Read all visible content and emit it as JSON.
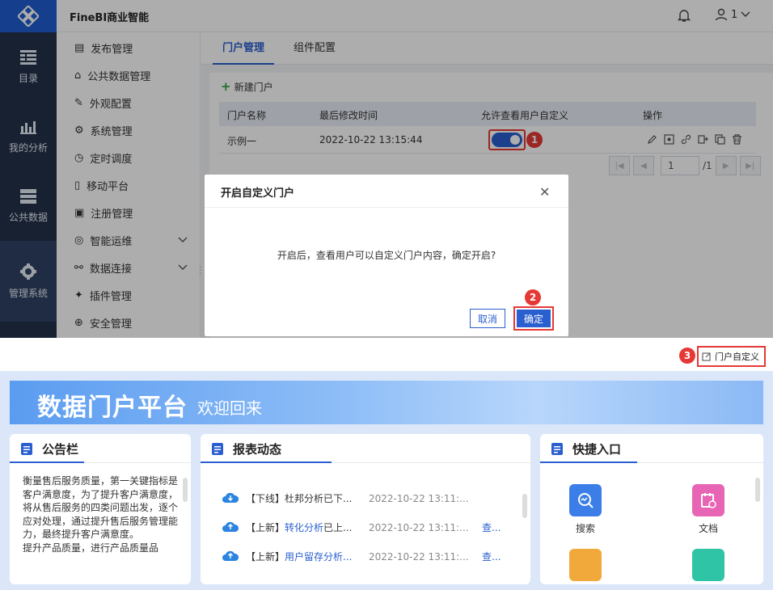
{
  "app": {
    "brand": "FineBI商业智能",
    "user": "1"
  },
  "leftnav": [
    {
      "label": "目录"
    },
    {
      "label": "我的分析"
    },
    {
      "label": "公共数据"
    },
    {
      "label": "管理系统"
    }
  ],
  "subnav": [
    {
      "label": "发布管理"
    },
    {
      "label": "公共数据管理"
    },
    {
      "label": "外观配置"
    },
    {
      "label": "系统管理"
    },
    {
      "label": "定时调度"
    },
    {
      "label": "移动平台"
    },
    {
      "label": "注册管理"
    },
    {
      "label": "智能运维"
    },
    {
      "label": "数据连接"
    },
    {
      "label": "插件管理"
    },
    {
      "label": "安全管理"
    }
  ],
  "tabs": [
    {
      "label": "门户管理"
    },
    {
      "label": "组件配置"
    }
  ],
  "toolbar": {
    "new_portal": "新建门户"
  },
  "table": {
    "headers": [
      "门户名称",
      "最后修改时间",
      "允许查看用户自定义",
      "操作"
    ],
    "rows": [
      {
        "name": "示例一",
        "time": "2022-10-22 13:15:44",
        "allow_custom": true
      }
    ]
  },
  "pager": {
    "page": "1",
    "total": "/1"
  },
  "dialog": {
    "title": "开启自定义门户",
    "message": "开启后，查看用户可以自定义门户内容，确定开启?",
    "cancel": "取消",
    "ok": "确定"
  },
  "steps": [
    "1",
    "2",
    "3"
  ],
  "portal": {
    "customize": "门户自定义",
    "banner_title": "数据门户平台",
    "banner_sub": "欢迎回来",
    "notice": {
      "title": "公告栏",
      "text": "衡量售后服务质量，第一关键指标是客户满意度，为了提升客户满意度，将从售后服务的四类问题出发，逐个应对处理，通过提升售后服务管理能力，最终提升客户满意度。",
      "text2": "提升产品质量，进行产品质量品"
    },
    "reports": {
      "title": "报表动态",
      "items": [
        {
          "tag": "【下线】",
          "name": "杜邦分析已下...",
          "time": "2022-10-22 13:11:...",
          "more": ""
        },
        {
          "tag": "【上新】",
          "name": "转化分析",
          "rest": "已上...",
          "time": "2022-10-22 13:11:...",
          "more": "查..."
        },
        {
          "tag": "【上新】",
          "name": "用户留存分析...",
          "time": "2022-10-22 13:11:...",
          "more": "查..."
        }
      ]
    },
    "quick": {
      "title": "快捷入口",
      "items": [
        {
          "label": "搜索"
        },
        {
          "label": "文档"
        }
      ]
    }
  },
  "colors": {
    "primary": "#2a5fcf",
    "sidebar": "#23324a",
    "highlight": "#e53935"
  }
}
